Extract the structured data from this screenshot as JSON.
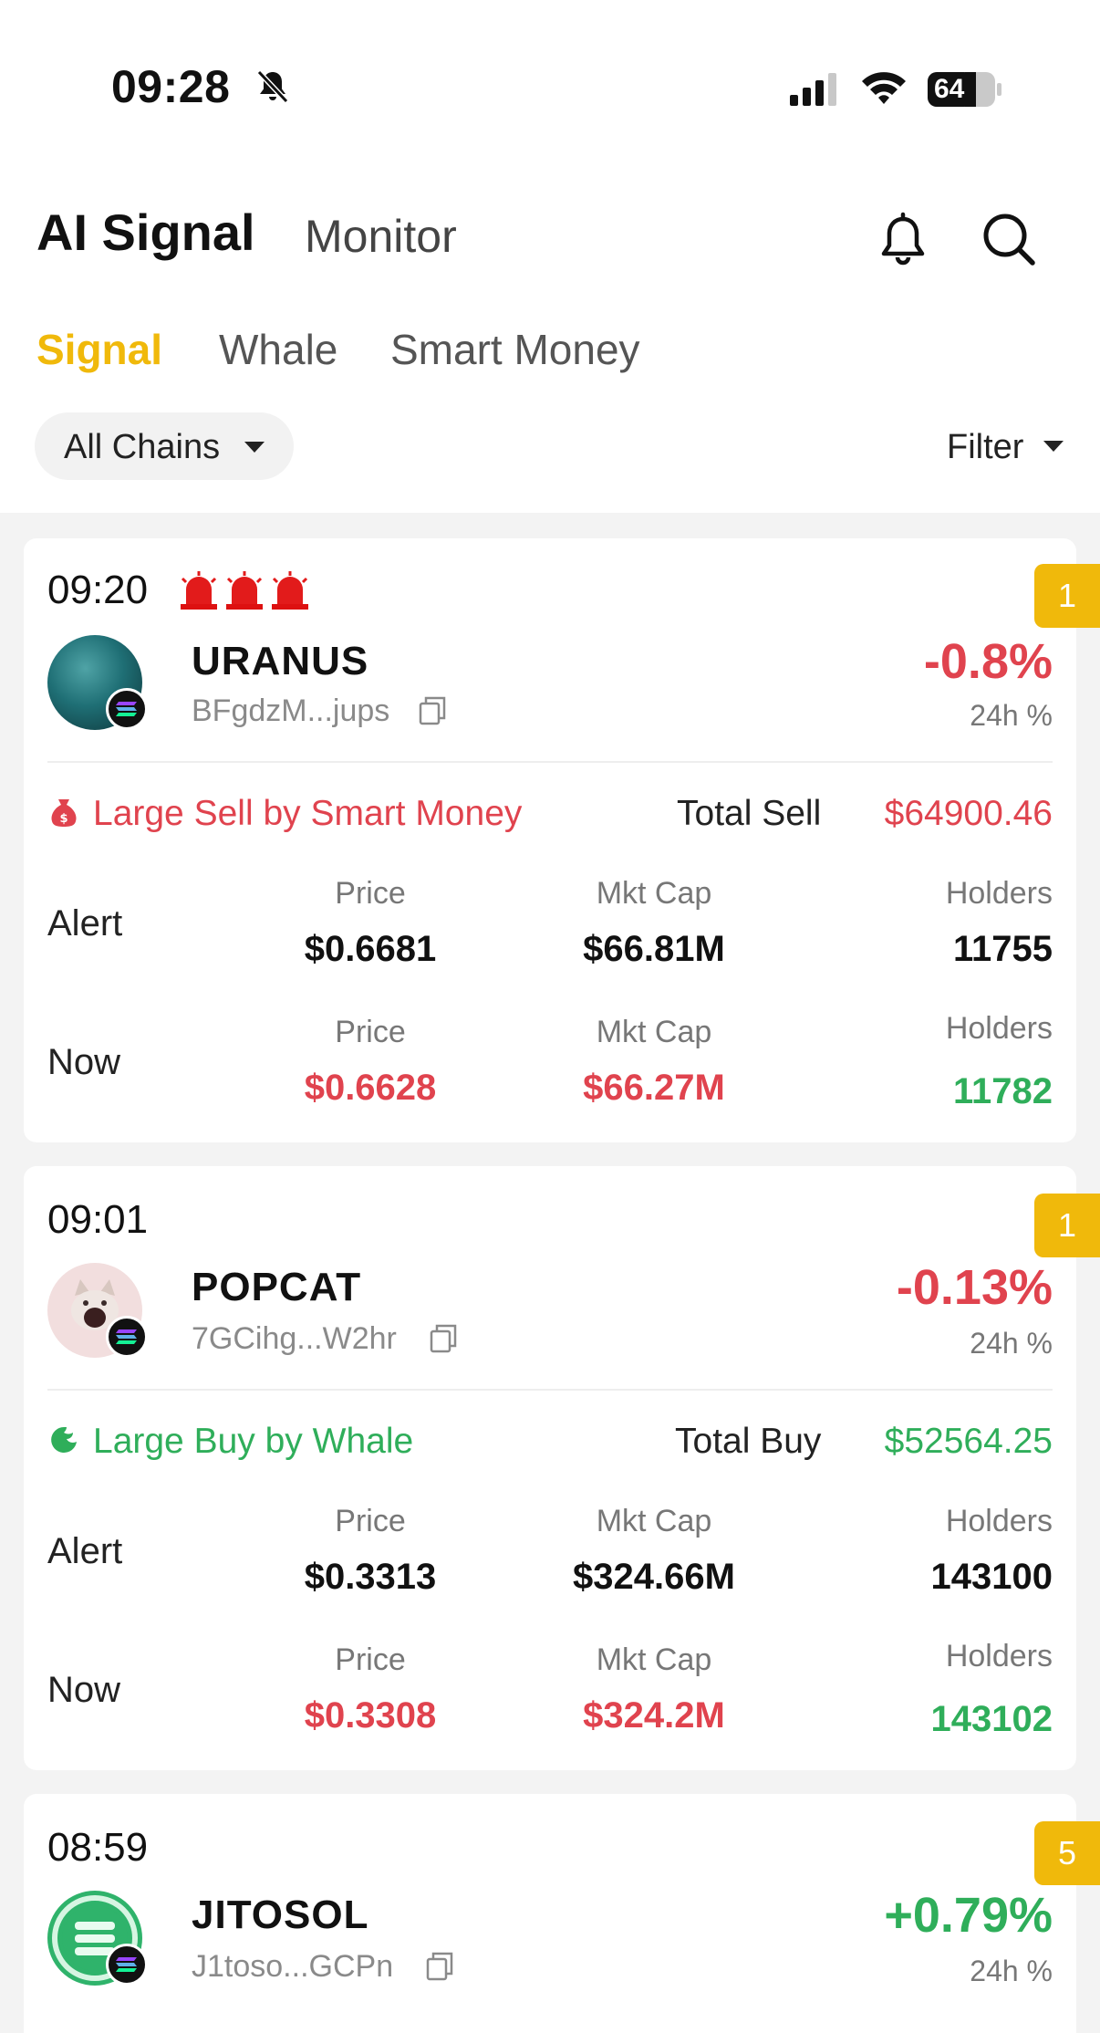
{
  "status_bar": {
    "time": "09:28",
    "battery": "64"
  },
  "header": {
    "title": "AI Signal",
    "secondary": "Monitor"
  },
  "tabs": [
    {
      "label": "Signal",
      "active": true
    },
    {
      "label": "Whale",
      "active": false
    },
    {
      "label": "Smart Money",
      "active": false
    }
  ],
  "chain_filter": {
    "label": "All Chains"
  },
  "filter": {
    "label": "Filter"
  },
  "colors": {
    "accent": "#f0b90b",
    "down": "#e0434e",
    "up": "#2fae5a"
  },
  "signals": [
    {
      "time": "09:20",
      "badge": "1",
      "icons": [
        "siren-icon",
        "siren-icon",
        "siren-icon"
      ],
      "token": "URANUS",
      "address": "BFgdzM...jups",
      "change": "-0.8%",
      "change_label": "24h %",
      "event": "Large Sell by Smart Money",
      "event_icon": "money-bag-icon",
      "total_label": "Total Sell",
      "total_value": "$64900.46",
      "alert": {
        "label": "Alert",
        "price_label": "Price",
        "price": "$0.6681",
        "mcap_label": "Mkt Cap",
        "mcap": "$66.81M",
        "holders_label": "Holders",
        "holders": "11755"
      },
      "now": {
        "label": "Now",
        "price_label": "Price",
        "price": "$0.6628",
        "mcap_label": "Mkt Cap",
        "mcap": "$66.27M",
        "holders_label": "Holders",
        "holders": "11782"
      }
    },
    {
      "time": "09:01",
      "badge": "1",
      "token": "POPCAT",
      "address": "7GCihg...W2hr",
      "change": "-0.13%",
      "change_label": "24h %",
      "event": "Large Buy by Whale",
      "event_icon": "whale-icon",
      "total_label": "Total Buy",
      "total_value": "$52564.25",
      "alert": {
        "label": "Alert",
        "price_label": "Price",
        "price": "$0.3313",
        "mcap_label": "Mkt Cap",
        "mcap": "$324.66M",
        "holders_label": "Holders",
        "holders": "143100"
      },
      "now": {
        "label": "Now",
        "price_label": "Price",
        "price": "$0.3308",
        "mcap_label": "Mkt Cap",
        "mcap": "$324.2M",
        "holders_label": "Holders",
        "holders": "143102"
      }
    },
    {
      "time": "08:59",
      "badge": "5",
      "token": "JITOSOL",
      "address": "J1toso...GCPn",
      "change": "+0.79%",
      "change_label": "24h %"
    }
  ]
}
